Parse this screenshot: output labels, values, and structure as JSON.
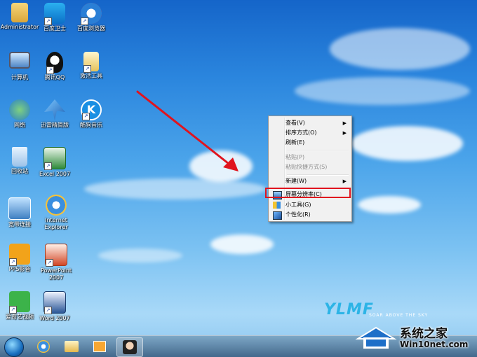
{
  "desktop": {
    "icons": [
      {
        "label": "Administrator"
      },
      {
        "label": "百度卫士"
      },
      {
        "label": "百度浏览器"
      },
      {
        "label": "计算机"
      },
      {
        "label": "腾讯QQ"
      },
      {
        "label": "激活工具"
      },
      {
        "label": "网络"
      },
      {
        "label": "迅雷精简版"
      },
      {
        "label": "酷狗音乐"
      },
      {
        "label": "回收站"
      },
      {
        "label": "Excel 2007"
      },
      {
        "label": "宽带连接"
      },
      {
        "label": "Internet Explorer"
      },
      {
        "label": "PPS影音"
      },
      {
        "label": "PowerPoint 2007"
      },
      {
        "label": "爱奇艺视频"
      },
      {
        "label": "Word 2007"
      }
    ]
  },
  "context_menu": {
    "items": [
      {
        "label": "查看(V)",
        "submenu": true,
        "enabled": true
      },
      {
        "label": "排序方式(O)",
        "submenu": true,
        "enabled": true
      },
      {
        "label": "刷新(E)",
        "submenu": false,
        "enabled": true
      },
      {
        "label": "粘贴(P)",
        "submenu": false,
        "enabled": false
      },
      {
        "label": "粘贴快捷方式(S)",
        "submenu": false,
        "enabled": false
      },
      {
        "label": "新建(W)",
        "submenu": true,
        "enabled": true
      },
      {
        "label": "屏幕分辨率(C)",
        "submenu": false,
        "enabled": true,
        "icon": "display-icon"
      },
      {
        "label": "小工具(G)",
        "submenu": false,
        "enabled": true,
        "icon": "gadgets-icon"
      },
      {
        "label": "个性化(R)",
        "submenu": false,
        "enabled": true,
        "icon": "personalize-icon"
      }
    ],
    "highlighted": "屏幕分辨率(C)"
  },
  "watermark": {
    "ylmf_logo": "YLMF",
    "slogan": "SOAR ABOVE THE SKY"
  },
  "site_logo": {
    "title": "系统之家",
    "url": "Win10net.com"
  },
  "colors": {
    "annotation_red": "#e0141e",
    "menu_bg": "#f1f1f1"
  }
}
